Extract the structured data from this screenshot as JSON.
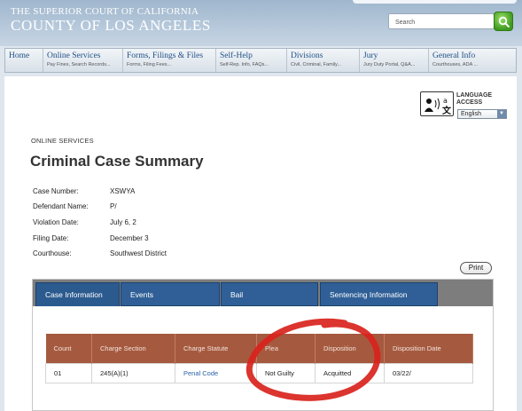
{
  "header": {
    "court_line1": "THE SUPERIOR COURT OF CALIFORNIA",
    "court_line2": "COUNTY OF LOS ANGELES",
    "search_placeholder": "Search"
  },
  "nav": [
    {
      "title": "Home",
      "sub": ""
    },
    {
      "title": "Online Services",
      "sub": "Pay Fines, Search Records..."
    },
    {
      "title": "Forms, Filings & Files",
      "sub": "Forms, Filing Fees..."
    },
    {
      "title": "Self-Help",
      "sub": "Self-Rep. Info, FAQs..."
    },
    {
      "title": "Divisions",
      "sub": "Civil, Criminal, Family..."
    },
    {
      "title": "Jury",
      "sub": "Jury Duty Portal, Q&A..."
    },
    {
      "title": "General Info",
      "sub": "Courthouses, ADA ..."
    }
  ],
  "language": {
    "label_line1": "LANGUAGE",
    "label_line2": "ACCESS",
    "selected": "English"
  },
  "page": {
    "eyebrow": "ONLINE SERVICES",
    "title": "Criminal Case Summary"
  },
  "case_info": [
    {
      "label": "Case Number:",
      "value": "XSWYA"
    },
    {
      "label": "Defendant Name:",
      "value": "P/"
    },
    {
      "label": "Violation Date:",
      "value": "July 6, 2"
    },
    {
      "label": "Filing Date:",
      "value": "December 3"
    },
    {
      "label": "Courthouse:",
      "value": "Southwest District"
    }
  ],
  "print_label": "Print",
  "tabs": [
    "Case Information",
    "Events",
    "Bail",
    "Sentencing Information"
  ],
  "charges_table": {
    "columns": [
      "Count",
      "Charge Section",
      "Charge Statute",
      "Plea",
      "Disposition",
      "Disposition Date"
    ],
    "rows": [
      [
        "01",
        "245(A)(1)",
        "Penal Code",
        "Not Guilty",
        "Acquitted",
        "03/22/"
      ]
    ]
  },
  "colors": {
    "tab_blue": "#2f5f96",
    "table_header": "#a55a3f",
    "annotation_red": "#d9231c"
  }
}
